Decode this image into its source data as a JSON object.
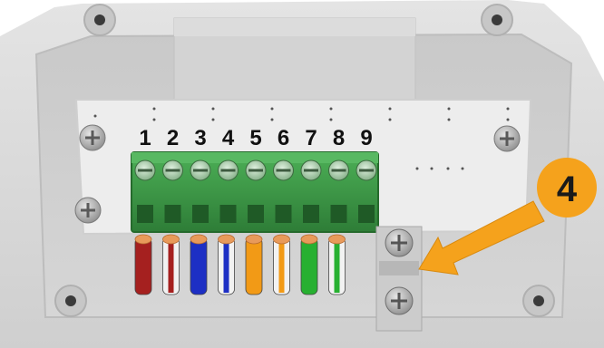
{
  "terminal_numbers": [
    "1",
    "2",
    "3",
    "4",
    "5",
    "6",
    "7",
    "8",
    "9"
  ],
  "step_badge": {
    "label": "4",
    "color": "#f5a21c"
  },
  "arrow_color": "#f5a21c",
  "colors": {
    "enclosure": "#d9d9d9",
    "pcb": "#eeeeee",
    "terminal_block": "#3f9a49",
    "screw": "#a8a8a8"
  },
  "wires": [
    {
      "name": "brown",
      "main": "#a5201f",
      "stripe": null
    },
    {
      "name": "white-brown",
      "main": "#f2f2f2",
      "stripe": "#a5201f"
    },
    {
      "name": "blue",
      "main": "#1d2fc4",
      "stripe": null
    },
    {
      "name": "white-blue",
      "main": "#f2f2f2",
      "stripe": "#1d2fc4"
    },
    {
      "name": "orange",
      "main": "#f29a16",
      "stripe": null
    },
    {
      "name": "white-orange",
      "main": "#f2f2f2",
      "stripe": "#f29a16"
    },
    {
      "name": "green",
      "main": "#27b031",
      "stripe": null
    },
    {
      "name": "white-green",
      "main": "#f2f2f2",
      "stripe": "#27b031"
    }
  ]
}
